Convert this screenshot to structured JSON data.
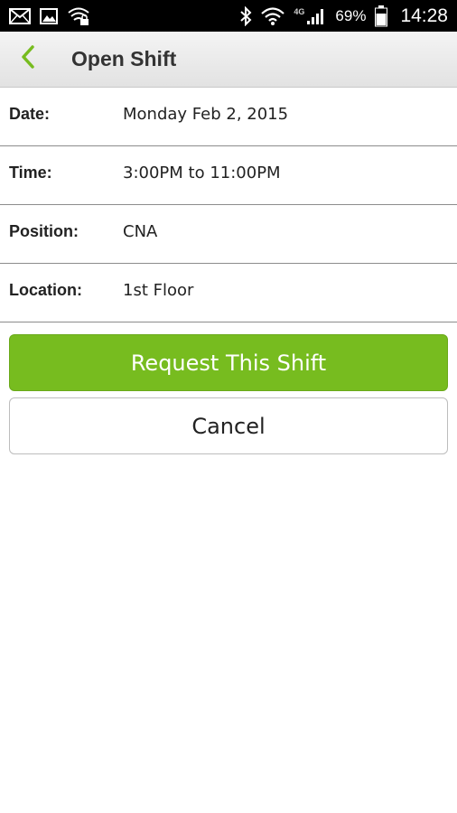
{
  "status_bar": {
    "battery": "69%",
    "time": "14:28",
    "network": "4G",
    "icons": [
      "mail-icon",
      "image-icon",
      "wifi-lock-icon",
      "bluetooth-icon",
      "wifi-icon",
      "signal-icon",
      "battery-icon"
    ]
  },
  "header": {
    "title": "Open Shift",
    "back_icon": "chevron-left-icon",
    "accent_color": "#77bc1f"
  },
  "details": [
    {
      "label": "Date:",
      "value": "Monday Feb 2, 2015"
    },
    {
      "label": "Time:",
      "value": "3:00PM to 11:00PM"
    },
    {
      "label": "Position:",
      "value": "CNA"
    },
    {
      "label": "Location:",
      "value": "1st Floor"
    }
  ],
  "actions": {
    "request_label": "Request This Shift",
    "cancel_label": "Cancel",
    "request_color": "#77bc1f"
  }
}
